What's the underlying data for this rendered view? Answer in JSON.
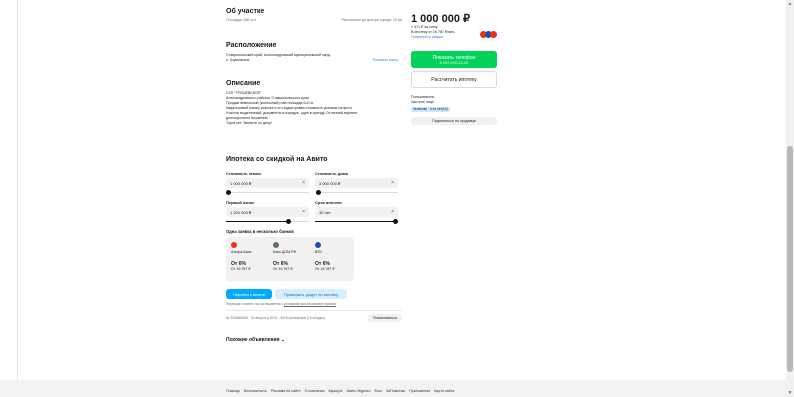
{
  "about": {
    "title": "Об участке",
    "area": "Площадь: 680 сот.",
    "distance": "Расстояние до центра города: 15 км"
  },
  "location": {
    "title": "Расположение",
    "address_line1": "Ставропольский край, Александровский муниципальный округ,",
    "address_line2": "с. Грушевское",
    "show_map": "Показать карту"
  },
  "description": {
    "title": "Описание",
    "lines": [
      "СХП \"ГРУШЕВСКОЕ\"",
      "Александровского района. Ставропольского края.",
      "Продам земельный (колхозный) пай площадь 6.8 га.",
      "Кадастровый номер участка и его кадастровая стоимость указаны на фото.",
      "Участок выделенный, документы в порядке, сдан в аренду. Отличный вариант",
      "долгосрочного вложения.",
      "Торга нет. Звоните по делу!"
    ]
  },
  "mortgage": {
    "title": "Ипотека со скидкой на Авито",
    "land_cost_label": "Стоимость земли",
    "land_cost_value": "1 000 000 ₽",
    "house_cost_label": "Стоимость дома",
    "house_cost_value": "3 000 000 ₽",
    "down_payment_label": "Первый взнос",
    "down_payment_value": "1 200 000 ₽",
    "term_label": "Срок ипотеки",
    "term_value": "30 лет",
    "banks_title": "Одна заявка в несколько банков",
    "banks": [
      {
        "name": "Альфа-Банк",
        "rate": "От 6%",
        "payment": "От 16 787 ₽",
        "color": "#e8321f"
      },
      {
        "name": "Банк ДОМ.РФ",
        "rate": "От 6%",
        "payment": "От 16 787 ₽",
        "color": "#5b6f7c"
      },
      {
        "name": "ВТБ",
        "rate": "От 6%",
        "payment": "От 16 787 ₽",
        "color": "#1d4fa8"
      }
    ],
    "apply_button": "Перейти к анкете",
    "check_button": "Проверить, дадут ли ипотеку",
    "consent_text": "Переходя к анкете, вы соглашаетесь с",
    "consent_link": "условиями использования сервиса"
  },
  "listing_meta": "№ 2624888435 · 31 августа в 20:51 · 5378 просмотров (+5 сегодня)",
  "report_button": "Пожаловаться",
  "similar": "Похожие объявления",
  "sidebar": {
    "price": "1 000 000 ₽",
    "per_unit": "1 471 ₽ за сотку",
    "mortgage_info": "В ипотеку от 16 787 ₽/мес.",
    "offers_link": "Посмотреть скидки",
    "phone_button": "Показать телефон",
    "phone_sub": "8 XXX XXX-XX-XX",
    "calc_button": "Рассчитать ипотеку",
    "seller_role": "Пользователь",
    "seller_type": "Частное лицо",
    "seller_since": "Зеленово · 6-ти лет(15)",
    "subscribe": "Подписаться на продавца",
    "brand_colors": [
      "#e8321f",
      "#1d4fa8",
      "#e8321f"
    ]
  },
  "footer": {
    "links": [
      "Помощь",
      "Безопасность",
      "Реклама на сайте",
      "О компании",
      "Карьера",
      "Авито Журнал",
      "Блог",
      "#яПомогаю",
      "Приложения",
      "Карта сайта"
    ]
  },
  "colors": {
    "green": "#02d15c",
    "blue": "#00aaff",
    "light_blue": "#d6eefd",
    "tag_blue": "#cfe7fa"
  }
}
